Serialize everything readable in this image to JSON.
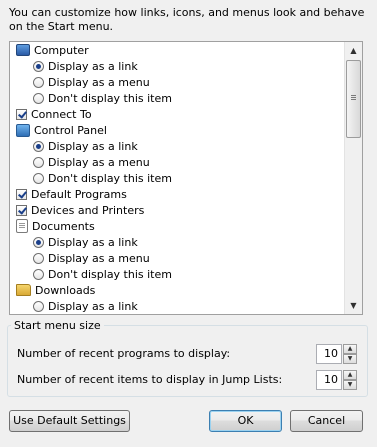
{
  "intro_text": "You can customize how links, icons, and menus look and behave on the Start menu.",
  "items": [
    {
      "kind": "category",
      "icon": "computer-icon",
      "label": "Computer"
    },
    {
      "kind": "radio",
      "checked": true,
      "label": "Display as a link"
    },
    {
      "kind": "radio",
      "checked": false,
      "label": "Display as a menu"
    },
    {
      "kind": "radio",
      "checked": false,
      "label": "Don't display this item"
    },
    {
      "kind": "checkbox",
      "checked": true,
      "label": "Connect To"
    },
    {
      "kind": "category",
      "icon": "control-panel-icon",
      "label": "Control Panel"
    },
    {
      "kind": "radio",
      "checked": true,
      "label": "Display as a link"
    },
    {
      "kind": "radio",
      "checked": false,
      "label": "Display as a menu"
    },
    {
      "kind": "radio",
      "checked": false,
      "label": "Don't display this item"
    },
    {
      "kind": "checkbox",
      "checked": true,
      "label": "Default Programs"
    },
    {
      "kind": "checkbox",
      "checked": true,
      "label": "Devices and Printers"
    },
    {
      "kind": "category",
      "icon": "documents-icon",
      "label": "Documents"
    },
    {
      "kind": "radio",
      "checked": true,
      "label": "Display as a link"
    },
    {
      "kind": "radio",
      "checked": false,
      "label": "Display as a menu"
    },
    {
      "kind": "radio",
      "checked": false,
      "label": "Don't display this item"
    },
    {
      "kind": "category",
      "icon": "downloads-folder-icon",
      "label": "Downloads"
    },
    {
      "kind": "radio",
      "checked": false,
      "label": "Display as a link"
    }
  ],
  "start_menu_size": {
    "title": "Start menu size",
    "recent_programs_label": "Number of recent programs to display:",
    "recent_programs_value": "10",
    "jump_list_label": "Number of recent items to display in Jump Lists:",
    "jump_list_value": "10"
  },
  "buttons": {
    "use_default": "Use Default Settings",
    "ok": "OK",
    "cancel": "Cancel"
  }
}
